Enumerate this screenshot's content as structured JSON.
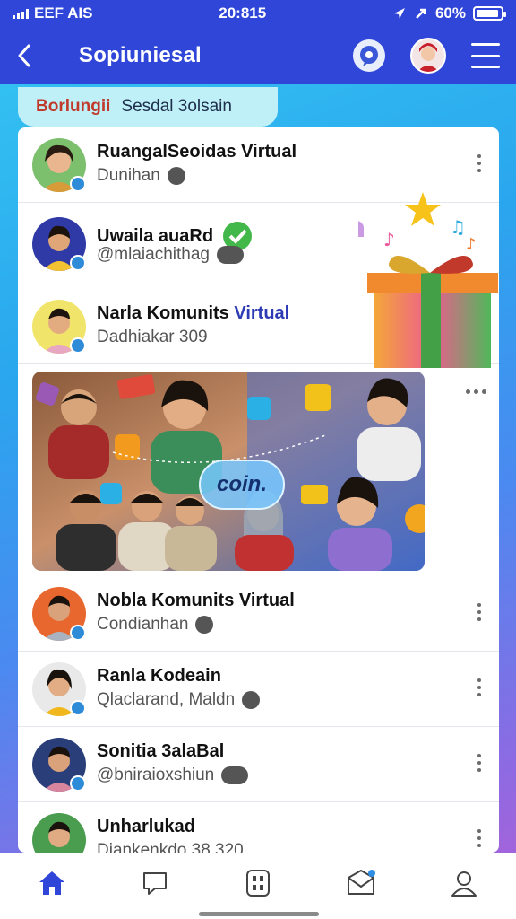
{
  "status_bar": {
    "carrier": "EEF AIS",
    "time": "20:815",
    "battery": "60%"
  },
  "header": {
    "title": "Sopiuniesal"
  },
  "top_pill": {
    "label_a": "Borlungii",
    "label_b": "Sesdal 3olsain"
  },
  "feed": {
    "rows": [
      {
        "name": "RuangalSeoidas Virtual",
        "name_accent": "",
        "sub": "Dunihan"
      },
      {
        "name": "Uwaila auaRd",
        "name_accent": "",
        "sub": "@mlaiachithag"
      },
      {
        "name": "Narla Komunits ",
        "name_accent": "Virtual",
        "sub": "Dadhiakar 309"
      }
    ],
    "post": {
      "coin_label": "coin."
    },
    "rows_after": [
      {
        "name": "Nobla Komunits Virtual",
        "sub": "Condianhan"
      },
      {
        "name": "Ranla Kodeain",
        "sub": "Qlaclarand, Maldn"
      },
      {
        "name": "Sonitia 3alaBal",
        "sub": "@bniraioxshiun"
      },
      {
        "name": "Unharlukad",
        "sub": "Diankenkdo 38 320"
      }
    ]
  },
  "nav": {
    "items": [
      "home-icon",
      "chat-icon",
      "apps-icon",
      "mail-icon",
      "profile-icon"
    ]
  },
  "colors": {
    "primary": "#2f46d8",
    "accent_text": "#2d3bb4",
    "pill_bg": "#bff0f7"
  }
}
